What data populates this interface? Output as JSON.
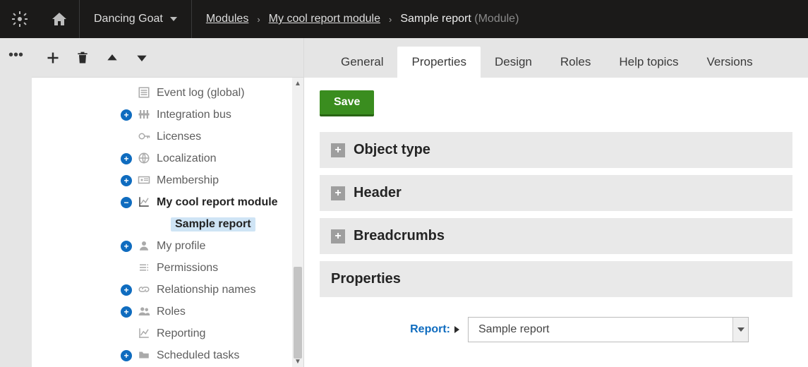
{
  "topbar": {
    "site_name": "Dancing Goat",
    "breadcrumbs": {
      "root": "Modules",
      "parent": "My cool report module",
      "current": "Sample report",
      "current_type": "(Module)"
    }
  },
  "sidebar_toolbar": {
    "add": "+",
    "delete": "trash",
    "up": "up",
    "down": "down"
  },
  "tree": [
    {
      "level": 1,
      "toggle": "none",
      "icon": "list",
      "label": "Event log (global)",
      "bold": false,
      "selected": false
    },
    {
      "level": 1,
      "toggle": "plus",
      "icon": "bus",
      "label": "Integration bus",
      "bold": false,
      "selected": false
    },
    {
      "level": 1,
      "toggle": "none",
      "icon": "key",
      "label": "Licenses",
      "bold": false,
      "selected": false
    },
    {
      "level": 1,
      "toggle": "plus",
      "icon": "globe",
      "label": "Localization",
      "bold": false,
      "selected": false
    },
    {
      "level": 1,
      "toggle": "plus",
      "icon": "card",
      "label": "Membership",
      "bold": false,
      "selected": false
    },
    {
      "level": 1,
      "toggle": "minus",
      "icon": "chart",
      "label": "My cool report module",
      "bold": true,
      "selected": false
    },
    {
      "level": 2,
      "toggle": "none",
      "icon": "",
      "label": "Sample report",
      "bold": true,
      "selected": true
    },
    {
      "level": 1,
      "toggle": "plus",
      "icon": "user",
      "label": "My profile",
      "bold": false,
      "selected": false
    },
    {
      "level": 1,
      "toggle": "none",
      "icon": "perm",
      "label": "Permissions",
      "bold": false,
      "selected": false
    },
    {
      "level": 1,
      "toggle": "plus",
      "icon": "link",
      "label": "Relationship names",
      "bold": false,
      "selected": false
    },
    {
      "level": 1,
      "toggle": "plus",
      "icon": "users",
      "label": "Roles",
      "bold": false,
      "selected": false
    },
    {
      "level": 1,
      "toggle": "none",
      "icon": "chart",
      "label": "Reporting",
      "bold": false,
      "selected": false
    },
    {
      "level": 1,
      "toggle": "plus",
      "icon": "folder",
      "label": "Scheduled tasks",
      "bold": false,
      "selected": false
    }
  ],
  "tabs": [
    "General",
    "Properties",
    "Design",
    "Roles",
    "Help topics",
    "Versions"
  ],
  "active_tab_index": 1,
  "save_label": "Save",
  "accordions": [
    {
      "title": "Object type",
      "expanded": false
    },
    {
      "title": "Header",
      "expanded": false
    },
    {
      "title": "Breadcrumbs",
      "expanded": false
    },
    {
      "title": "Properties",
      "expanded": true
    }
  ],
  "form": {
    "report_label": "Report:",
    "report_value": "Sample report"
  }
}
